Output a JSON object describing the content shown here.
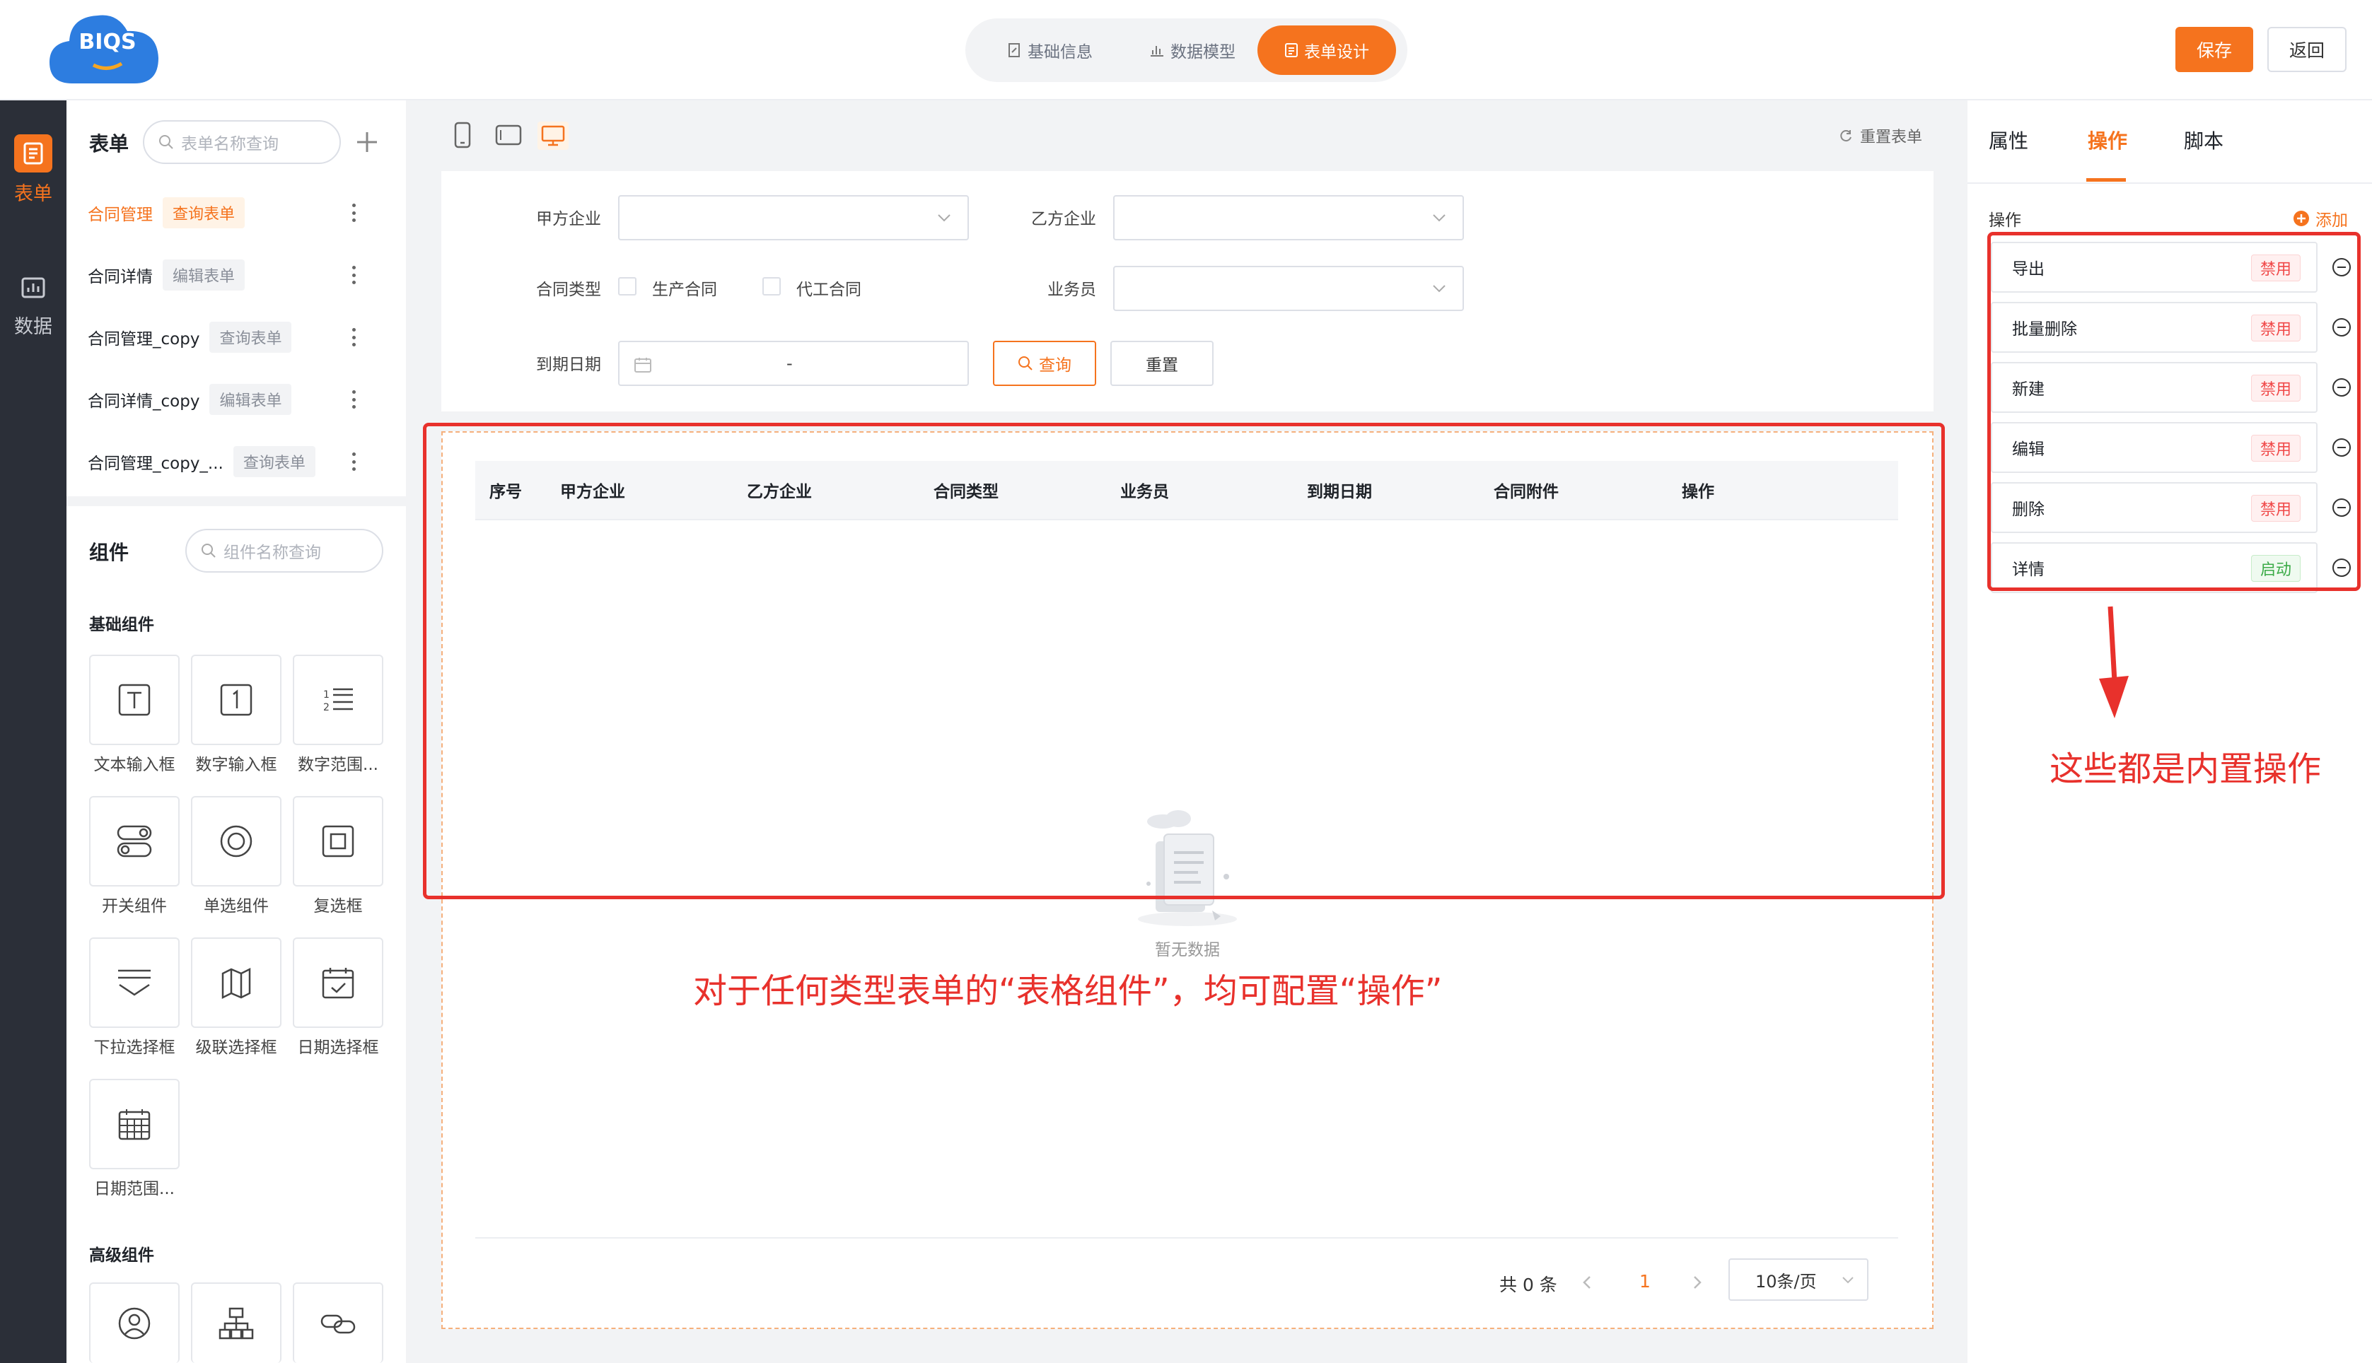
{
  "header": {
    "logo_text": "BIQS",
    "steps": [
      {
        "label": "基础信息"
      },
      {
        "label": "数据模型"
      },
      {
        "label": "表单设计"
      }
    ],
    "save_label": "保存",
    "back_label": "返回"
  },
  "rail": {
    "items": [
      {
        "label": "表单",
        "icon": "form-icon"
      },
      {
        "label": "数据",
        "icon": "chart-icon"
      }
    ]
  },
  "forms_panel": {
    "title": "表单",
    "search_placeholder": "表单名称查询",
    "items": [
      {
        "name": "合同管理",
        "tag": "查询表单"
      },
      {
        "name": "合同详情",
        "tag": "编辑表单"
      },
      {
        "name": "合同管理_copy",
        "tag": "查询表单"
      },
      {
        "name": "合同详情_copy",
        "tag": "编辑表单"
      },
      {
        "name": "合同管理_copy_...",
        "tag": "查询表单"
      }
    ]
  },
  "components_panel": {
    "title": "组件",
    "search_placeholder": "组件名称查询",
    "basic_title": "基础组件",
    "basic": [
      {
        "label": "文本输入框",
        "icon": "text-input-icon"
      },
      {
        "label": "数字输入框",
        "icon": "number-input-icon"
      },
      {
        "label": "数字范围...",
        "icon": "number-range-icon"
      },
      {
        "label": "开关组件",
        "icon": "switch-icon"
      },
      {
        "label": "单选组件",
        "icon": "radio-icon"
      },
      {
        "label": "复选框",
        "icon": "checkbox-icon"
      },
      {
        "label": "下拉选择框",
        "icon": "dropdown-icon"
      },
      {
        "label": "级联选择框",
        "icon": "cascader-icon"
      },
      {
        "label": "日期选择框",
        "icon": "date-picker-icon"
      },
      {
        "label": "日期范围...",
        "icon": "date-range-icon"
      }
    ],
    "advanced_title": "高级组件",
    "advanced": [
      {
        "icon": "user-icon"
      },
      {
        "icon": "org-chart-icon"
      },
      {
        "icon": "link-icon"
      }
    ]
  },
  "canvas": {
    "reset_label": "重置表单",
    "filters": {
      "party_a": "甲方企业",
      "party_b": "乙方企业",
      "contract_type": "合同类型",
      "type_options": [
        "生产合同",
        "代工合同"
      ],
      "salesman": "业务员",
      "due_date": "到期日期",
      "date_separator": "-",
      "query_label": "查询",
      "reset_label": "重置"
    },
    "table": {
      "columns": [
        "序号",
        "甲方企业",
        "乙方企业",
        "合同类型",
        "业务员",
        "到期日期",
        "合同附件",
        "操作"
      ],
      "empty_text": "暂无数据"
    },
    "pagination": {
      "total": "共 0 条",
      "current_page": "1",
      "page_size": "10条/页"
    }
  },
  "right_panel": {
    "tabs": [
      "属性",
      "操作",
      "脚本"
    ],
    "active_tab": "操作",
    "section_title": "操作",
    "add_label": "添加",
    "operations": [
      {
        "name": "导出",
        "status": "禁用"
      },
      {
        "name": "批量删除",
        "status": "禁用"
      },
      {
        "name": "新建",
        "status": "禁用"
      },
      {
        "name": "编辑",
        "status": "禁用"
      },
      {
        "name": "删除",
        "status": "禁用"
      },
      {
        "name": "详情",
        "status": "启动"
      }
    ]
  },
  "annotations": {
    "builtin_note": "这些都是内置操作",
    "table_note": "对于任何类型表单的“表格组件”，均可配置“操作”"
  },
  "colors": {
    "accent": "#f5731e",
    "rail_bg": "#2b2f38",
    "annotation_red": "#e8312c"
  }
}
